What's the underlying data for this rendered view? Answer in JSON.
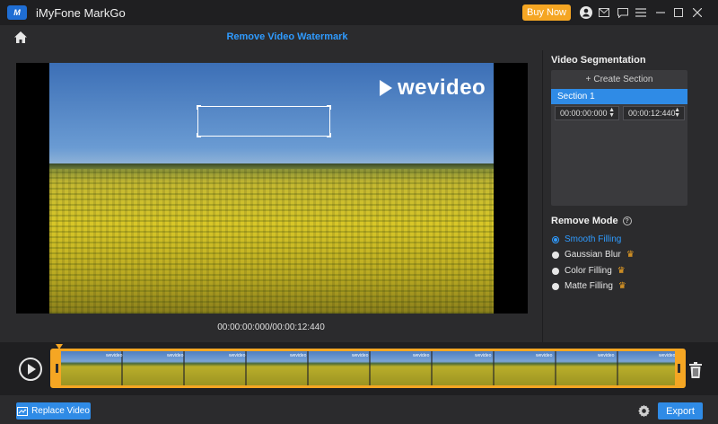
{
  "window": {
    "app_title": "iMyFone MarkGo",
    "logo_text": "M",
    "buy_now_label": "Buy Now",
    "controls": [
      "user-icon",
      "mail-icon",
      "feedback-icon",
      "menu-icon",
      "minimize-icon",
      "maximize-icon",
      "close-icon"
    ]
  },
  "toolbar": {
    "page_title": "Remove Video Watermark"
  },
  "preview": {
    "watermark_text": "wevideo",
    "time_readout": "00:00:00:000/00:00:12:440"
  },
  "segmentation": {
    "title": "Video Segmentation",
    "create_section_label": "Create Section",
    "section_label": "Section 1",
    "start_time": "00:00:00:000",
    "end_time": "00:00:12:440"
  },
  "remove_mode": {
    "title": "Remove Mode",
    "options": [
      {
        "label": "Smooth Filling",
        "selected": true,
        "premium": false
      },
      {
        "label": "Gaussian Blur",
        "selected": false,
        "premium": true
      },
      {
        "label": "Color Filling",
        "selected": false,
        "premium": true
      },
      {
        "label": "Matte Filling",
        "selected": false,
        "premium": true
      }
    ]
  },
  "timeline": {
    "thumbnail_watermark": "wevideo"
  },
  "bottom": {
    "replace_label": "Replace Video",
    "export_label": "Export"
  },
  "colors": {
    "accent": "#2f8be6",
    "title_accent": "#2f9bff",
    "buy_now": "#f5a623",
    "premium_crown": "#f5a623"
  }
}
